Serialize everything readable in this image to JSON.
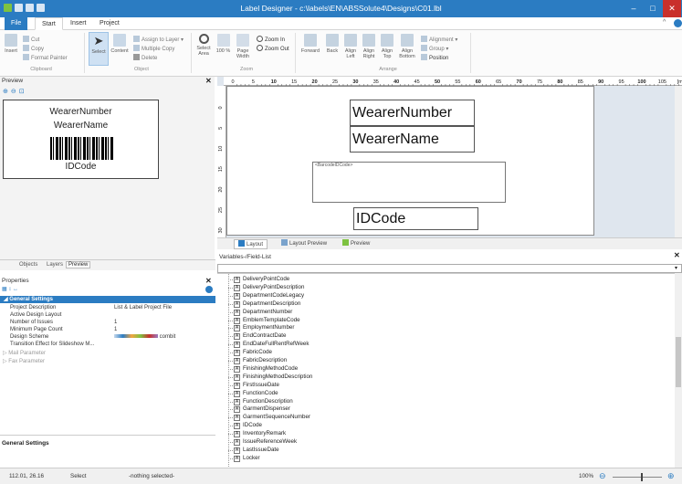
{
  "window": {
    "title": "Label Designer - c:\\labels\\EN\\ABSSolute4\\Designs\\C01.lbl",
    "controls": {
      "minimize": "–",
      "maximize": "□",
      "close": "✕"
    }
  },
  "tabs": [
    {
      "label": "File"
    },
    {
      "label": "Start"
    },
    {
      "label": "Insert"
    },
    {
      "label": "Project"
    }
  ],
  "ribbon": {
    "clipboard": {
      "insert": "Insert",
      "cut": "Cut",
      "copy": "Copy",
      "format_painter": "Format Painter",
      "group": "Clipboard"
    },
    "object": {
      "select": "Select",
      "content": "Content",
      "assign_to_layer": "Assign to Layer ▾",
      "multiple_copy": "Multiple Copy",
      "delete": "Delete",
      "group": "Object"
    },
    "zoom": {
      "select_area": "Select Area",
      "hundred": "100 %",
      "page_width": "Page Width",
      "zoom_in": "Zoom In",
      "zoom_out": "Zoom Out",
      "group": "Zoom"
    },
    "arrange": {
      "forward": "Forward",
      "back": "Back",
      "align_left": "Align Left",
      "align_right": "Align Right",
      "align_top": "Align Top",
      "align_bottom": "Align Bottom",
      "alignment": "Alignment ▾",
      "group_btn": "Group ▾",
      "position": "Position",
      "group": "Arrange"
    }
  },
  "preview": {
    "title": "Preview",
    "label_fields": {
      "wearer_number": "WearerNumber",
      "wearer_name": "WearerName",
      "id_code": "IDCode"
    }
  },
  "left_tabs": [
    {
      "label": "Objects"
    },
    {
      "label": "Layers"
    },
    {
      "label": "Preview"
    }
  ],
  "properties": {
    "title": "Properties",
    "section": "General Settings",
    "rows": [
      {
        "key": "Project Description",
        "value": "List & Label Project File"
      },
      {
        "key": "Active Design Layout",
        "value": ""
      },
      {
        "key": "Number of Issues",
        "value": "1"
      },
      {
        "key": "Minimum Page Count",
        "value": "1"
      },
      {
        "key": "Design Scheme",
        "value": "combit"
      },
      {
        "key": "Transition Effect for Slideshow M...",
        "value": ""
      }
    ],
    "collapsed": [
      {
        "label": "Mail Parameter"
      },
      {
        "label": "Fax Parameter"
      }
    ],
    "footer": "General Settings"
  },
  "design": {
    "ruler_ticks": [
      "0",
      "5",
      "10",
      "15",
      "20",
      "25",
      "30",
      "35",
      "40",
      "45",
      "50",
      "55",
      "60",
      "65",
      "70",
      "75",
      "80",
      "85",
      "90",
      "95",
      "100",
      "105",
      "[mm]"
    ],
    "vruler_ticks": [
      "0",
      "5",
      "10",
      "15",
      "20",
      "25",
      "30"
    ],
    "fields": {
      "wearer_number": "WearerNumber",
      "wearer_name": "WearerName",
      "barcode": "<BarcodeIDCode>",
      "id_code": "IDCode"
    }
  },
  "bottom_tabs": [
    {
      "label": "Layout"
    },
    {
      "label": "Layout Preview"
    },
    {
      "label": "Preview"
    }
  ],
  "variables": {
    "title": "Variables-/Field-List",
    "tag": "A",
    "items": [
      "DeliveryPointCode",
      "DeliveryPointDescription",
      "DepartmentCodeLegacy",
      "DepartmentDescription",
      "DepartmentNumber",
      "EmblemTemplateCode",
      "EmploymentNumber",
      "EndContractDate",
      "EndDateFullRentRefWeek",
      "FabricCode",
      "FabricDescription",
      "FinishingMethodCode",
      "FinishingMethodDescription",
      "FirstIssueDate",
      "FunctionCode",
      "FunctionDescription",
      "GarmentDispenser",
      "GarmentSequenceNumber",
      "IDCode",
      "InventoryRemark",
      "IssueReferenceWeek",
      "LastIssueDate",
      "Locker"
    ]
  },
  "status": {
    "coords": "112.01, 26.16",
    "mode": "Select",
    "selection": "-nothing selected-",
    "zoom": "100%",
    "zoom_out": "⊖",
    "zoom_in": "⊕"
  },
  "colors": {
    "titlebar": "#2b7cc2",
    "section_header": "#2b7cc2",
    "close": "#c9302c"
  }
}
